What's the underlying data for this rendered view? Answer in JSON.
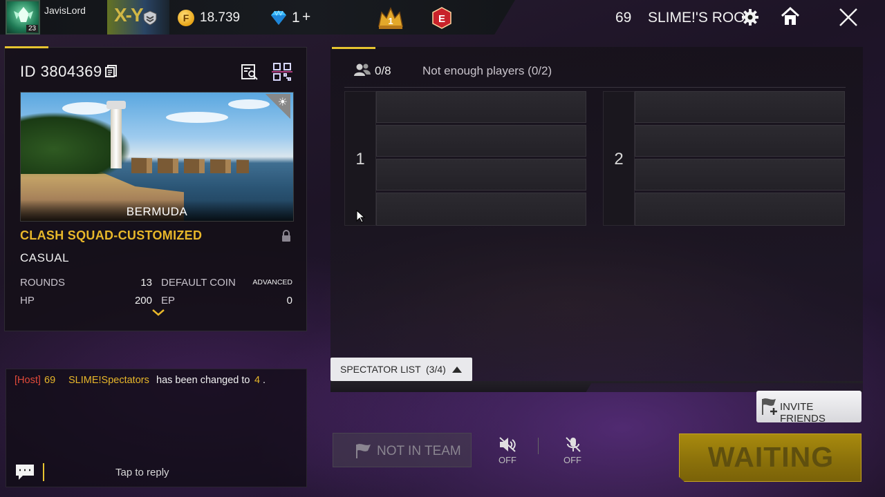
{
  "topbar": {
    "username": "JavisLord",
    "level": "23",
    "badge_text": "X-Y",
    "coins": "18.739",
    "diamonds": "1",
    "diamonds_plus": "+",
    "coin_symbol": "F",
    "room_number": "69",
    "room_name": "SLIME!'S ROO",
    "elite_letter": "E",
    "rank_number": "1"
  },
  "room": {
    "id_label": "ID",
    "id_value": "3804369",
    "map_name": "BERMUDA",
    "mode": "CLASH SQUAD-CUSTOMIZED",
    "sub_mode": "CASUAL",
    "rows": [
      {
        "label": "ROUNDS",
        "value": "13",
        "label2": "DEFAULT COIN",
        "value2": "ADVANCED"
      },
      {
        "label": "HP",
        "value": "200",
        "label2": "EP",
        "value2": "0"
      }
    ]
  },
  "chat": {
    "host_tag": "[Host]",
    "host_num": "69",
    "host_name": "SLIME!Spectators",
    "message": "has been changed to",
    "value": "4",
    "suffix": ".",
    "reply_placeholder": "Tap to reply"
  },
  "lobby": {
    "player_count": "0/8",
    "status": "Not enough players (0/2)",
    "teams": [
      {
        "number": "1",
        "slots": [
          "",
          "",
          "",
          ""
        ]
      },
      {
        "number": "2",
        "slots": [
          "",
          "",
          "",
          ""
        ]
      }
    ],
    "spectator_label": "SPECTATOR LIST",
    "spectator_count": "(3/4)"
  },
  "actions": {
    "invite_label": "INVITE FRIENDS",
    "not_in_team": "NOT IN TEAM",
    "speaker_state": "OFF",
    "mic_state": "OFF",
    "waiting": "WAITING"
  },
  "colors": {
    "accent_yellow": "#e7c430",
    "mode_orange": "#e8b72a",
    "host_red": "#e24a3a",
    "waiting_gold": "#a88a0e"
  }
}
